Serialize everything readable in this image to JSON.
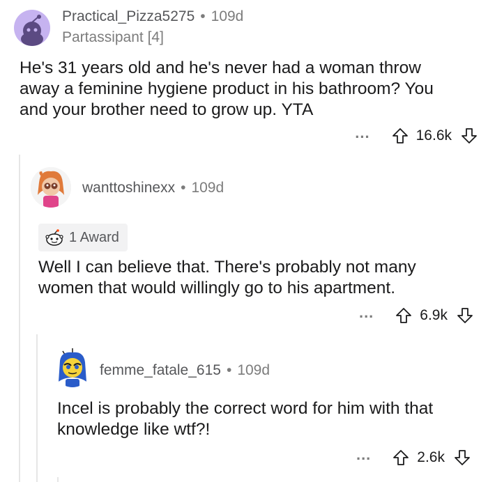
{
  "comments": [
    {
      "username": "Practical_Pizza5275",
      "age": "109d",
      "flair": "Partassipant [4]",
      "body_lines": [
        "He's 31 years old and he's never had a woman throw",
        "away a feminine hygiene product in his bathroom? You",
        "and your brother need to grow up. YTA"
      ],
      "score": "16.6k"
    },
    {
      "username": "wanttoshinexx",
      "age": "109d",
      "award": "1 Award",
      "body_lines": [
        "Well I can believe that. There's probably not many",
        "women that would willingly go to his apartment."
      ],
      "score": "6.9k"
    },
    {
      "username": "femme_fatale_615",
      "age": "109d",
      "body_lines": [
        "Incel is probably the correct word for him with that",
        "knowledge like wtf?!"
      ],
      "score": "2.6k"
    }
  ],
  "separator": "•",
  "more_label": "...",
  "colors": {
    "text": "#1a1a1b",
    "meta": "#7c7c7c",
    "thread_line": "#e6e6e6",
    "default_avatar_bg": "#c6b3f0"
  }
}
